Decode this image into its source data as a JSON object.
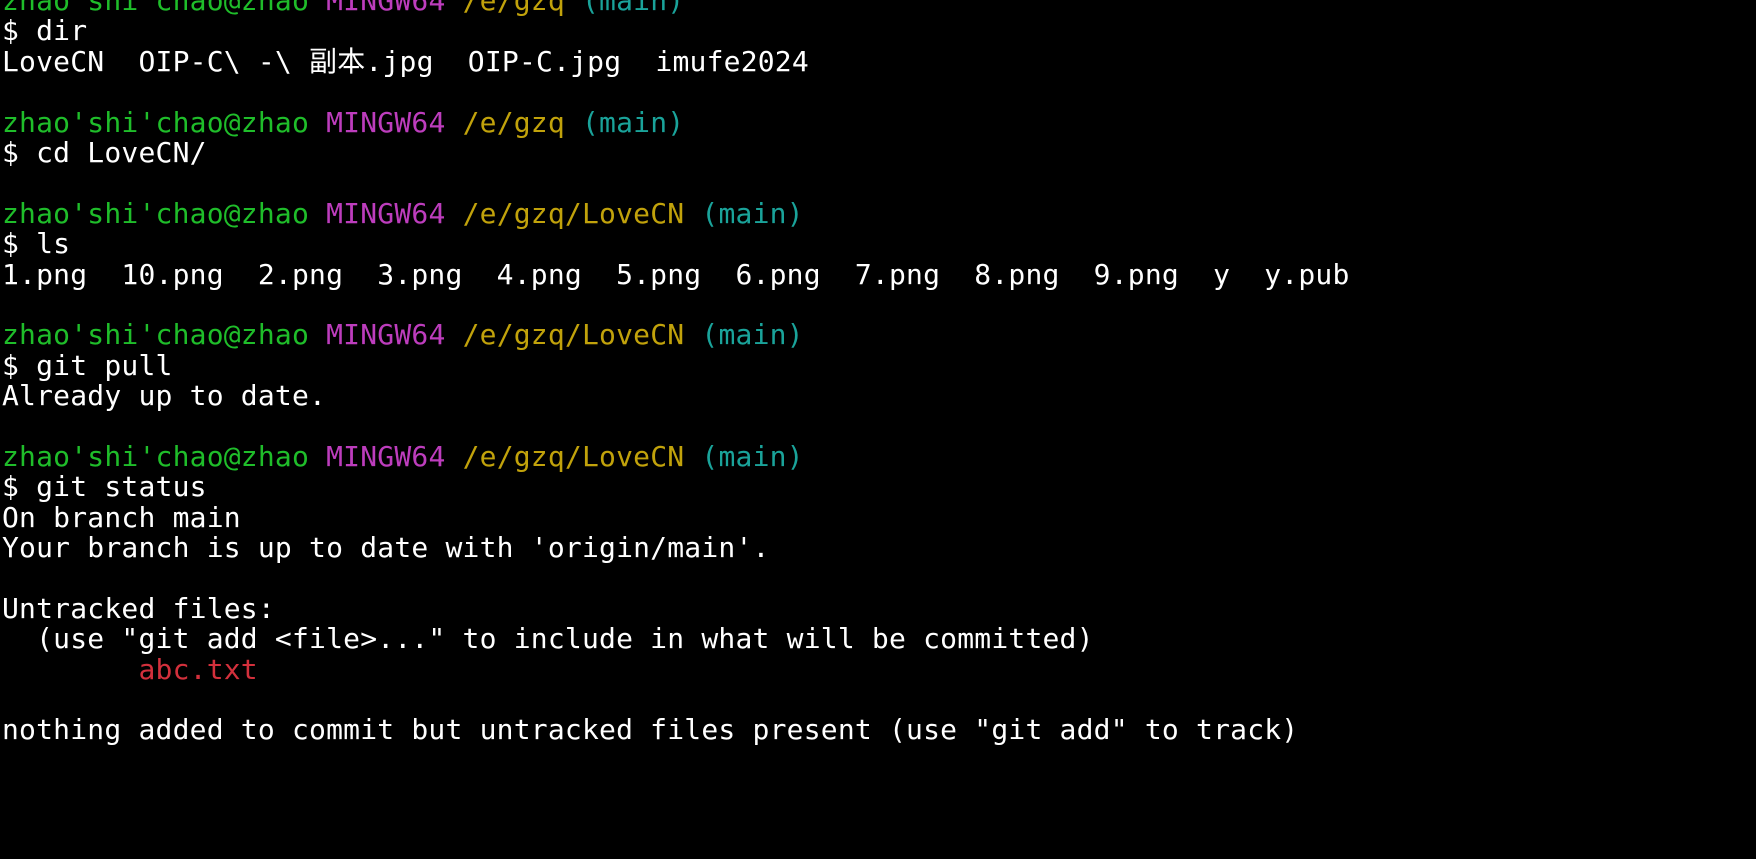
{
  "terminal": {
    "colors": {
      "background": "#000000",
      "text": "#ffffff",
      "user": "#1fbd2a",
      "system": "#bd3dbd",
      "path": "#c1a20b",
      "branch": "#1aa39a",
      "untracked": "#d3303c"
    },
    "lines": [
      {
        "type": "prompt",
        "user": "zhao'shi'chao@zhao",
        "system": "MINGW64",
        "path": "/e/gzq",
        "branch": "(main)"
      },
      {
        "type": "command",
        "text": "$ dir"
      },
      {
        "type": "output",
        "text": "LoveCN  OIP-C\\ -\\ 副本.jpg  OIP-C.jpg  imufe2024"
      },
      {
        "type": "blank",
        "text": ""
      },
      {
        "type": "prompt",
        "user": "zhao'shi'chao@zhao",
        "system": "MINGW64",
        "path": "/e/gzq",
        "branch": "(main)"
      },
      {
        "type": "command",
        "text": "$ cd LoveCN/"
      },
      {
        "type": "blank",
        "text": ""
      },
      {
        "type": "prompt",
        "user": "zhao'shi'chao@zhao",
        "system": "MINGW64",
        "path": "/e/gzq/LoveCN",
        "branch": "(main)"
      },
      {
        "type": "command",
        "text": "$ ls"
      },
      {
        "type": "output",
        "text": "1.png  10.png  2.png  3.png  4.png  5.png  6.png  7.png  8.png  9.png  y  y.pub"
      },
      {
        "type": "blank",
        "text": ""
      },
      {
        "type": "prompt",
        "user": "zhao'shi'chao@zhao",
        "system": "MINGW64",
        "path": "/e/gzq/LoveCN",
        "branch": "(main)"
      },
      {
        "type": "command",
        "text": "$ git pull"
      },
      {
        "type": "output",
        "text": "Already up to date."
      },
      {
        "type": "blank",
        "text": ""
      },
      {
        "type": "prompt",
        "user": "zhao'shi'chao@zhao",
        "system": "MINGW64",
        "path": "/e/gzq/LoveCN",
        "branch": "(main)"
      },
      {
        "type": "command",
        "text": "$ git status"
      },
      {
        "type": "output",
        "text": "On branch main"
      },
      {
        "type": "output",
        "text": "Your branch is up to date with 'origin/main'."
      },
      {
        "type": "blank",
        "text": ""
      },
      {
        "type": "output",
        "text": "Untracked files:"
      },
      {
        "type": "output",
        "text": "  (use \"git add <file>...\" to include in what will be committed)"
      },
      {
        "type": "untracked",
        "text": "        abc.txt"
      },
      {
        "type": "blank",
        "text": ""
      },
      {
        "type": "output",
        "text": "nothing added to commit but untracked files present (use \"git add\" to track)"
      }
    ]
  }
}
